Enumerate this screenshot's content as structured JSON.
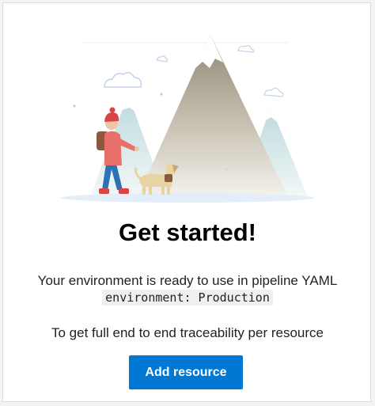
{
  "heading": "Get started!",
  "description": "Your environment is ready to use in pipeline YAML",
  "code_snippet": "environment: Production",
  "traceability_text": "To get full end to end traceability per resource",
  "button_label": "Add resource",
  "colors": {
    "accent": "#0078d4",
    "mountain": "#b5ad9c",
    "snow": "#ffffff"
  },
  "illustration_icons": [
    "mountain-icon",
    "cloud-icon",
    "hiker-icon",
    "dog-icon"
  ]
}
